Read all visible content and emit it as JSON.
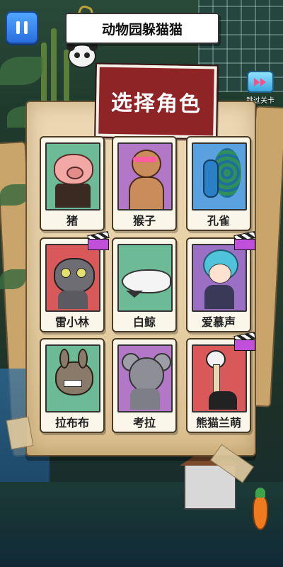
{
  "top_bar": {
    "pause_icon": "pause-icon",
    "title": "动物园躲猫猫",
    "skip_label": "跳过关卡",
    "skip_icon": "skip-level-icon"
  },
  "panel": {
    "title": "选择角色",
    "characters": [
      {
        "name": "猪",
        "bg": "#6dbb96",
        "has_video_badge": false
      },
      {
        "name": "猴子",
        "bg": "#b277c6",
        "has_video_badge": false
      },
      {
        "name": "孔雀",
        "bg": "#5aa2df",
        "has_video_badge": false
      },
      {
        "name": "雷小林",
        "bg": "#d9595a",
        "has_video_badge": true
      },
      {
        "name": "白鲸",
        "bg": "#6dbb96",
        "has_video_badge": false
      },
      {
        "name": "爱慕声",
        "bg": "#9b6fc4",
        "has_video_badge": true
      },
      {
        "name": "拉布布",
        "bg": "#6dbb96",
        "has_video_badge": false
      },
      {
        "name": "考拉",
        "bg": "#b277c6",
        "has_video_badge": false
      },
      {
        "name": "熊猫兰萌",
        "bg": "#d9595a",
        "has_video_badge": true
      }
    ]
  },
  "colors": {
    "stamp_red": "#8e2426",
    "paper": "#ecd8b3",
    "button_blue": "#2a6fe0"
  }
}
